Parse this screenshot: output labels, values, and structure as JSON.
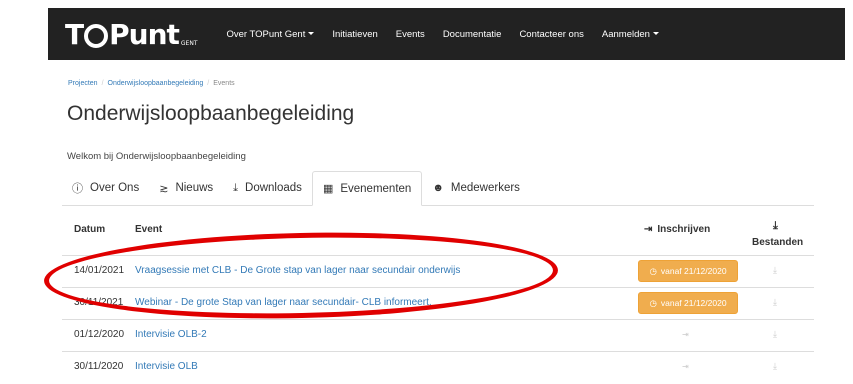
{
  "brand": {
    "logo_text_a": "T",
    "logo_text_b": "Punt",
    "logo_sub": "GENT"
  },
  "nav": [
    {
      "label": "Over TOPunt Gent",
      "dropdown": true
    },
    {
      "label": "Initiatieven",
      "dropdown": false
    },
    {
      "label": "Events",
      "dropdown": false
    },
    {
      "label": "Documentatie",
      "dropdown": false
    },
    {
      "label": "Contacteer ons",
      "dropdown": false
    },
    {
      "label": "Aanmelden",
      "dropdown": true
    }
  ],
  "breadcrumb": {
    "items": [
      "Projecten",
      "Onderwijsloopbaanbegeleiding",
      "Events"
    ]
  },
  "page": {
    "title": "Onderwijsloopbaanbegeleiding",
    "welcome": "Welkom bij Onderwijsloopbaanbegeleiding"
  },
  "tabs": [
    {
      "label": "Over Ons",
      "icon": "info-circle-icon",
      "glyph": "ℹ",
      "active": false
    },
    {
      "label": "Nieuws",
      "icon": "rss-icon",
      "glyph": ")",
      "active": false
    },
    {
      "label": "Downloads",
      "icon": "download-icon",
      "glyph": "⤓",
      "active": false
    },
    {
      "label": "Evenementen",
      "icon": "calendar-icon",
      "glyph": "▦",
      "active": true
    },
    {
      "label": "Medewerkers",
      "icon": "users-icon",
      "glyph": "☻",
      "active": false
    }
  ],
  "table": {
    "headers": {
      "date": "Datum",
      "event": "Event",
      "signup": "Inschrijven",
      "files_a": "Bestanden",
      "files_icon": "⤓"
    },
    "rows": [
      {
        "date": "14/01/2021",
        "event": "Vraagsessie met CLB - De Grote stap van lager naar secundair onderwijs",
        "signup": "vanaf 21/12/2020"
      },
      {
        "date": "30/11/2021",
        "event": "Webinar - De grote Stap van lager naar secundair- CLB informeert.",
        "signup": "vanaf 21/12/2020"
      },
      {
        "date": "01/12/2020",
        "event": "Intervisie OLB-2",
        "signup": ""
      },
      {
        "date": "30/11/2020",
        "event": "Intervisie OLB",
        "signup": ""
      }
    ],
    "signup_icon": "⇥",
    "clock_icon": "◷"
  },
  "colors": {
    "navbar": "#222222",
    "link": "#337ab7",
    "warning": "#f0ad4e",
    "annotation": "#e00000"
  }
}
